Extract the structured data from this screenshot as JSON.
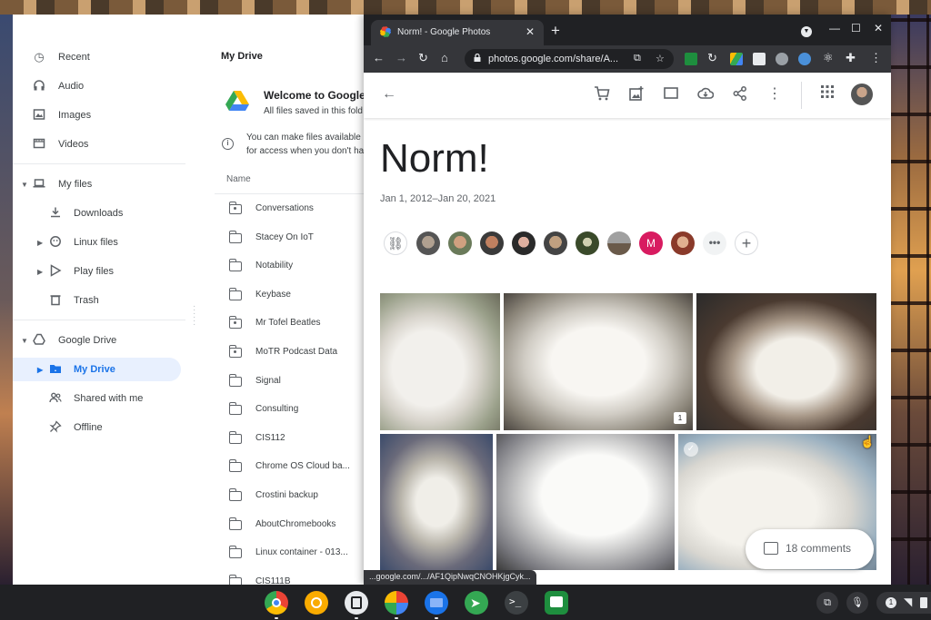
{
  "files_app": {
    "nav": [
      {
        "label": "Recent"
      },
      {
        "label": "Audio"
      },
      {
        "label": "Images"
      },
      {
        "label": "Videos"
      },
      {
        "label": "My files"
      },
      {
        "label": "Downloads"
      },
      {
        "label": "Linux files"
      },
      {
        "label": "Play files"
      },
      {
        "label": "Trash"
      },
      {
        "label": "Google Drive"
      },
      {
        "label": "My Drive"
      },
      {
        "label": "Shared with me"
      },
      {
        "label": "Offline"
      }
    ],
    "title": "My Drive",
    "welcome_title": "Welcome to Google D",
    "welcome_sub": "All files saved in this fold",
    "info_line1": "You can make files available",
    "info_line2": "for access when you don't ha",
    "column_name": "Name",
    "files": [
      "Conversations",
      "Stacey On IoT",
      "Notability",
      "Keybase",
      "Mr Tofel Beatles",
      "MoTR Podcast Data",
      "Signal",
      "Consulting",
      "CIS112",
      "Chrome OS Cloud ba...",
      "Crostini backup",
      "AboutChromebooks",
      "Linux container - 013...",
      "CIS111B"
    ]
  },
  "browser": {
    "tab_title": "Norm! - Google Photos",
    "url": "photos.google.com/share/A...",
    "status_url": "...google.com/.../AF1QipNwqCNOHKjgCyk..."
  },
  "photos": {
    "album_title": "Norm!",
    "date_range": "Jan 1, 2012–Jan 20, 2021",
    "member_initial": "M",
    "comment_badge": "1",
    "comments_label": "18 comments"
  },
  "colors": {
    "accent": "#1a73e8",
    "active_nav_bg": "#e8f0fe",
    "chrome_dark": "#202124",
    "chrome_toolbar": "#35363a",
    "member_pink": "#d81b60"
  }
}
